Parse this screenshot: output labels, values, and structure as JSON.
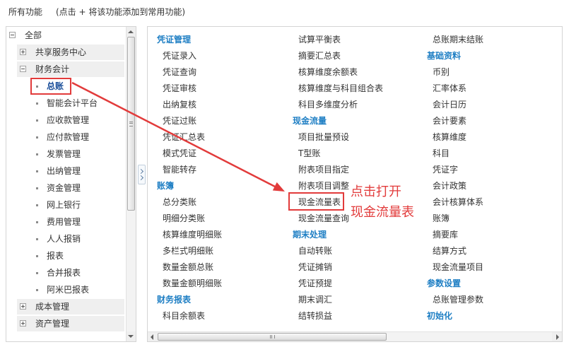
{
  "header": {
    "title": "所有功能",
    "hint": "(点击 + 将该功能添加到常用功能)"
  },
  "tree": {
    "root": {
      "label": "全部",
      "expanded": true
    },
    "groups": [
      {
        "label": "共享服务中心",
        "expanded": false,
        "children": []
      },
      {
        "label": "财务会计",
        "expanded": true,
        "children": [
          {
            "label": "总账",
            "selected": true,
            "highlighted": true
          },
          {
            "label": "智能会计平台"
          },
          {
            "label": "应收款管理"
          },
          {
            "label": "应付款管理"
          },
          {
            "label": "发票管理"
          },
          {
            "label": "出纳管理"
          },
          {
            "label": "资金管理"
          },
          {
            "label": "网上银行"
          },
          {
            "label": "费用管理"
          },
          {
            "label": "人人报销"
          },
          {
            "label": "报表"
          },
          {
            "label": "合并报表"
          },
          {
            "label": "阿米巴报表"
          }
        ]
      },
      {
        "label": "成本管理",
        "expanded": false,
        "children": []
      },
      {
        "label": "资产管理",
        "expanded": false,
        "children": []
      }
    ]
  },
  "functions": {
    "columns": [
      [
        {
          "label": "凭证管理",
          "is_header": true
        },
        {
          "label": "凭证录入"
        },
        {
          "label": "凭证查询"
        },
        {
          "label": "凭证审核"
        },
        {
          "label": "出纳复核"
        },
        {
          "label": "凭证过账"
        },
        {
          "label": "凭证汇总表"
        },
        {
          "label": "模式凭证"
        },
        {
          "label": "智能转存"
        },
        {
          "label": "账簿",
          "is_header": true
        },
        {
          "label": "总分类账"
        },
        {
          "label": "明细分类账"
        },
        {
          "label": "核算维度明细账"
        },
        {
          "label": "多栏式明细账"
        },
        {
          "label": "数量金额总账"
        },
        {
          "label": "数量金额明细账"
        },
        {
          "label": "财务报表",
          "is_header": true
        },
        {
          "label": "科目余额表"
        }
      ],
      [
        {
          "label": "试算平衡表"
        },
        {
          "label": "摘要汇总表"
        },
        {
          "label": "核算维度余额表"
        },
        {
          "label": "核算维度与科目组合表"
        },
        {
          "label": "科目多维度分析"
        },
        {
          "label": "现金流量",
          "is_header": true
        },
        {
          "label": "项目批量预设"
        },
        {
          "label": "T型账"
        },
        {
          "label": "附表项目指定"
        },
        {
          "label": "附表项目调整"
        },
        {
          "label": "现金流量表",
          "highlighted": true
        },
        {
          "label": "现金流量查询"
        },
        {
          "label": "期末处理",
          "is_header": true
        },
        {
          "label": "自动转账"
        },
        {
          "label": "凭证摊销"
        },
        {
          "label": "凭证预提"
        },
        {
          "label": "期末调汇"
        },
        {
          "label": "结转损益"
        }
      ],
      [
        {
          "label": "总账期末结账"
        },
        {
          "label": "基础资料",
          "is_header": true
        },
        {
          "label": "币别"
        },
        {
          "label": "汇率体系"
        },
        {
          "label": "会计日历"
        },
        {
          "label": "会计要素"
        },
        {
          "label": "核算维度"
        },
        {
          "label": "科目"
        },
        {
          "label": "凭证字"
        },
        {
          "label": "会计政策"
        },
        {
          "label": "会计核算体系"
        },
        {
          "label": "账簿"
        },
        {
          "label": "摘要库"
        },
        {
          "label": "结算方式"
        },
        {
          "label": "现金流量项目"
        },
        {
          "label": "参数设置",
          "is_header": true
        },
        {
          "label": "总账管理参数"
        },
        {
          "label": "初始化",
          "is_header": true
        }
      ]
    ]
  },
  "annotation": {
    "line1": "点击打开",
    "line2": "现金流量表"
  },
  "scrollbars": {
    "tree_vertical": {
      "position": 0,
      "visible_fraction": 0.59
    },
    "functions_horizontal": {
      "position": 0,
      "visible_fraction": 0.58
    }
  },
  "icons": {
    "expanded_node": "collapse-node-icon",
    "collapsed_node": "expand-node-icon",
    "leaf": "bullet-icon"
  },
  "colors": {
    "category_blue": "#1f7fc4",
    "annotation_red": "#e23b3b",
    "text": "#333333"
  }
}
